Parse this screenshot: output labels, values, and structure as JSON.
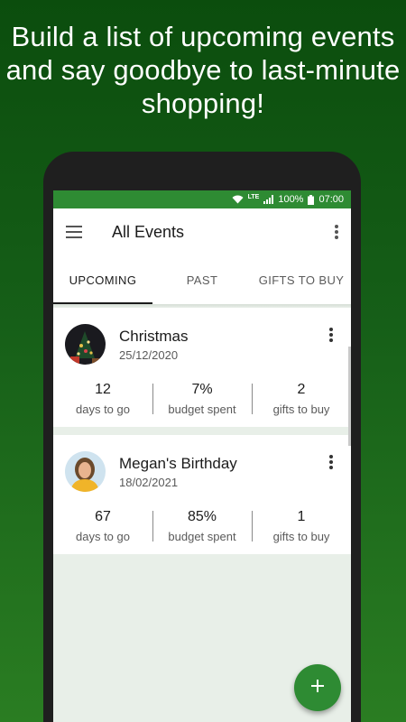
{
  "promo": {
    "line1": "Build a list of upcoming events",
    "line2": "and say goodbye to last-minute",
    "line3": "shopping!"
  },
  "statusbar": {
    "network": "LTE",
    "battery": "100%",
    "time": "07:00",
    "icons": [
      "wifi-icon",
      "signal-icon",
      "battery-icon"
    ]
  },
  "appbar": {
    "title": "All Events",
    "icons": [
      "menu-icon",
      "more-vert-icon"
    ]
  },
  "tabs": [
    {
      "label": "UPCOMING",
      "active": true
    },
    {
      "label": "PAST",
      "active": false
    },
    {
      "label": "GIFTS TO BUY",
      "active": false
    }
  ],
  "events": [
    {
      "name": "Christmas",
      "date": "25/12/2020",
      "avatar": "christmas-tree-photo",
      "stats": [
        {
          "value": "12",
          "label": "days to go"
        },
        {
          "value": "7%",
          "label": "budget spent"
        },
        {
          "value": "2",
          "label": "gifts to buy"
        }
      ]
    },
    {
      "name": "Megan's Birthday",
      "date": "18/02/2021",
      "avatar": "person-photo",
      "stats": [
        {
          "value": "67",
          "label": "days to go"
        },
        {
          "value": "85%",
          "label": "budget spent"
        },
        {
          "value": "1",
          "label": "gifts to buy"
        }
      ]
    }
  ],
  "fab": {
    "icon": "plus-icon"
  },
  "colors": {
    "primary": "#2e8b33",
    "background_top": "#0b4d0d",
    "screen_bg": "#e8efe8"
  }
}
